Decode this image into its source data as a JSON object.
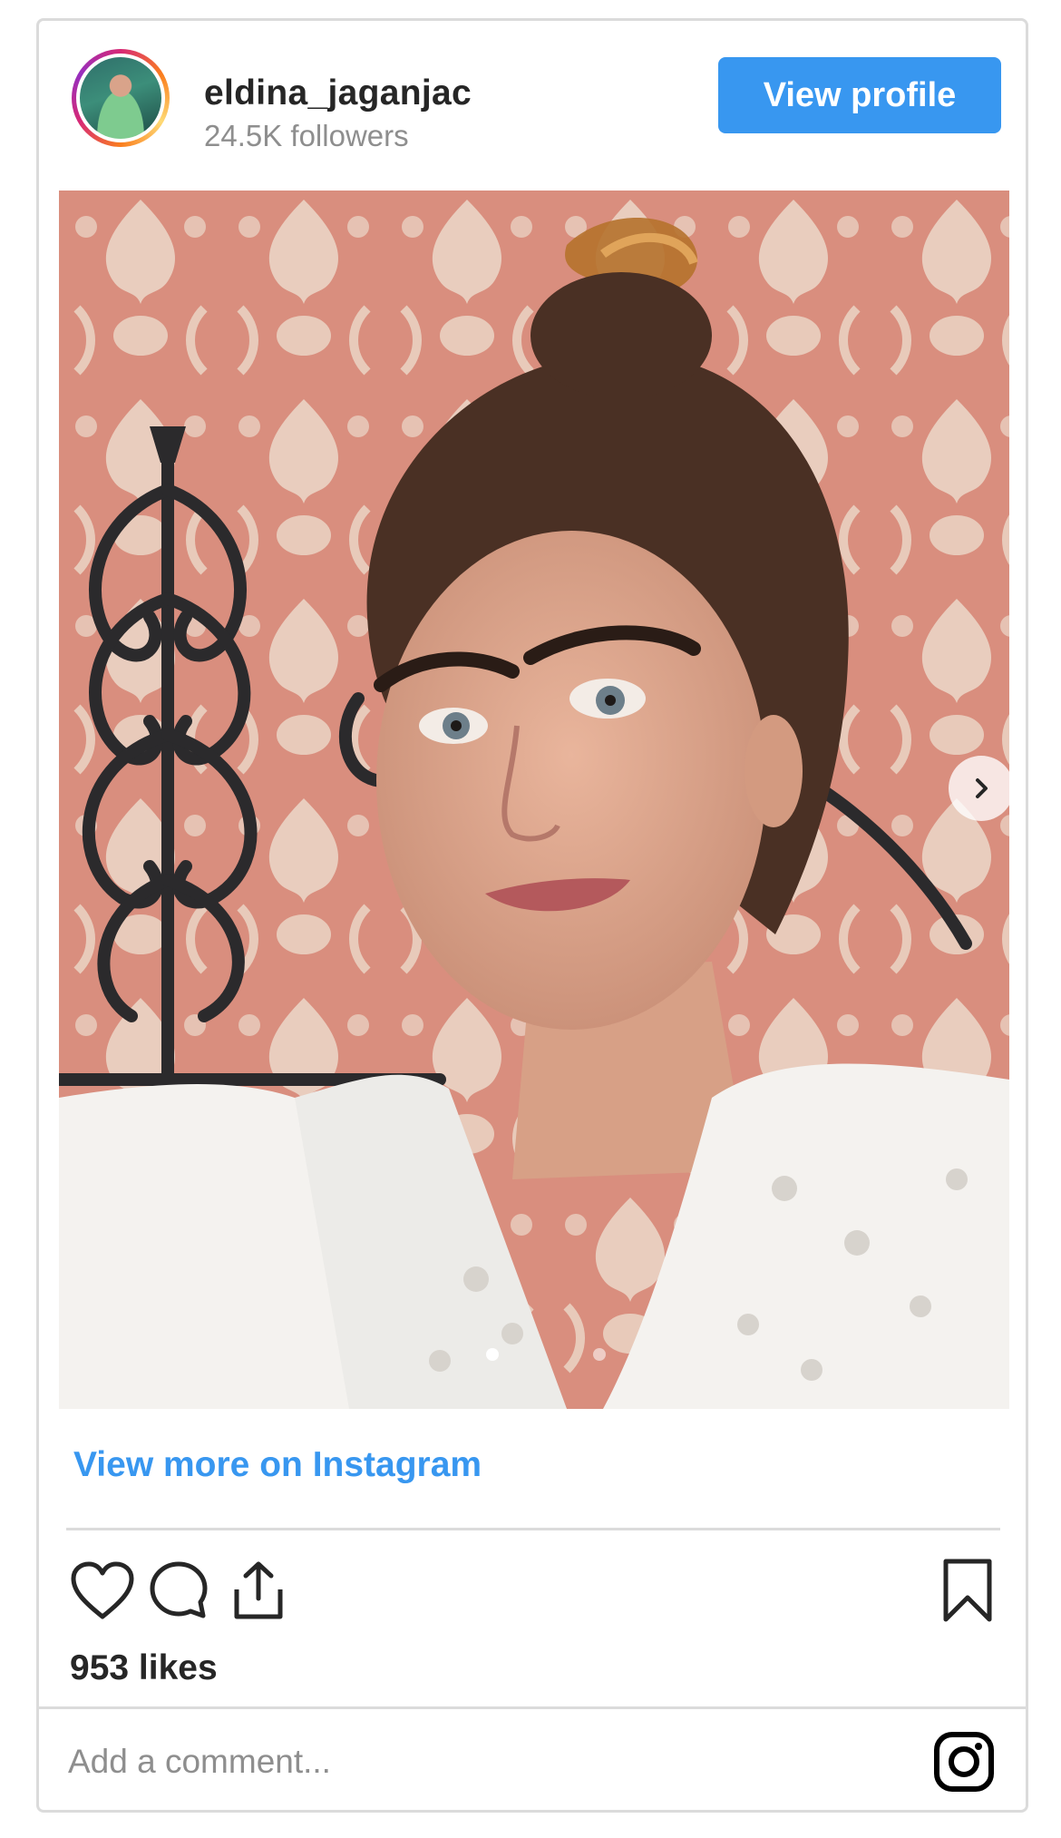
{
  "header": {
    "username": "eldina_jaganjac",
    "followers": "24.5K followers",
    "view_profile_label": "View profile"
  },
  "post": {
    "carousel": {
      "slide_count": 2,
      "active_slide": 1
    },
    "view_more_label": "View more on Instagram",
    "likes": "953 likes"
  },
  "comment": {
    "placeholder": "Add a comment..."
  },
  "icons": {
    "like": "heart-icon",
    "comment": "comment-icon",
    "share": "share-icon",
    "save": "bookmark-icon",
    "next": "chevron-right-icon",
    "brand": "instagram-icon"
  },
  "colors": {
    "accent": "#3897f0",
    "border": "#dbdbdb",
    "muted_text": "#8e8e8e",
    "text": "#262626"
  }
}
